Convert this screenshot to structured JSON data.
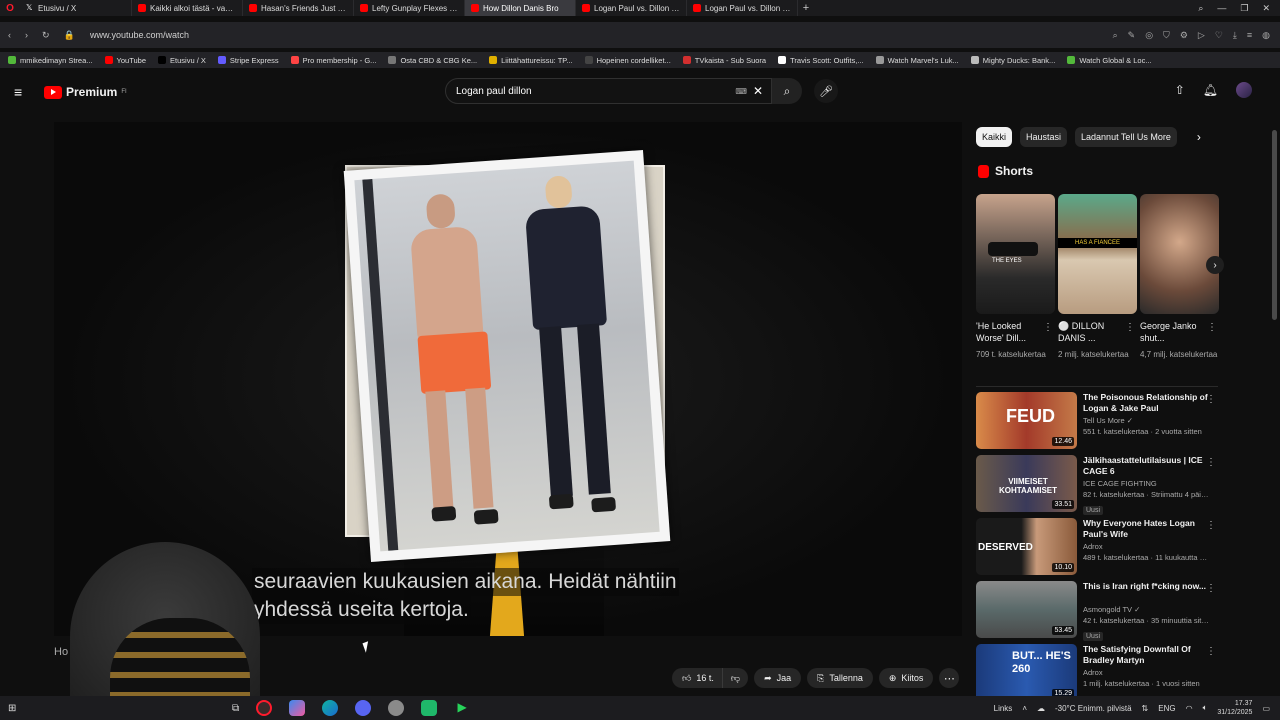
{
  "browser": {
    "tabs": [
      {
        "label": "Etusivu / X",
        "icon": "x-icon",
        "active": false
      },
      {
        "label": "Kaikki alkoi tästä - vapaaottelu",
        "icon": "youtube-icon",
        "active": false
      },
      {
        "label": "Hasan's Friends Just Expo",
        "icon": "youtube-icon",
        "active": false
      },
      {
        "label": "Lefty Gunplay Flexes his C",
        "icon": "youtube-icon",
        "active": false
      },
      {
        "label": "How Dillon Danis Bro",
        "icon": "youtube-icon",
        "active": true
      },
      {
        "label": "Logan Paul vs. Dillon Dan",
        "icon": "youtube-icon",
        "active": false
      },
      {
        "label": "Logan Paul vs. Dillon Dan",
        "icon": "youtube-icon",
        "active": false
      }
    ],
    "url": "www.youtube.com/watch",
    "bookmarks": [
      {
        "label": "mmikedimayn Strea...",
        "color": "#53b93b"
      },
      {
        "label": "YouTube",
        "color": "#ff0000"
      },
      {
        "label": "Etusivu / X",
        "color": "#000000"
      },
      {
        "label": "Stripe Express",
        "color": "#635bff"
      },
      {
        "label": "Pro membership - G...",
        "color": "#ff4444"
      },
      {
        "label": "Osta CBD & CBG Ke...",
        "color": "#777777"
      },
      {
        "label": "Liittähattureissu: TP...",
        "color": "#e0b000"
      },
      {
        "label": "Hopeinen cordelliket...",
        "color": "#444444"
      },
      {
        "label": "TVkaista - Sub Suora",
        "color": "#d32f2f"
      },
      {
        "label": "Travis Scott: Outfits,...",
        "color": "#ffffff"
      },
      {
        "label": "Watch Marvel's Luk...",
        "color": "#999999"
      },
      {
        "label": "Mighty Ducks: Bank...",
        "color": "#bbbbbb"
      },
      {
        "label": "Watch Global & Loc...",
        "color": "#53b93b"
      }
    ]
  },
  "youtube": {
    "logo_text": "Premium",
    "logo_sup": "FI",
    "search_value": "Logan paul dillon",
    "player": {
      "subtitle_line1": "seuraavien kuukausien aikana. Heidät nähtiin",
      "subtitle_line2": "yhdessä useita kertoja.",
      "webcam_text": "Ho"
    },
    "actions": {
      "likes": "16 t.",
      "share": "Jaa",
      "save": "Tallenna",
      "thanks": "Kiitos"
    },
    "chips": [
      "Kaikki",
      "Haustasi",
      "Ladannut Tell Us More"
    ],
    "shorts_header": "Shorts",
    "shorts": [
      {
        "title": "'He Looked Worse' Dill...",
        "views": "709 t. katselukertaa",
        "thumb_label": "THE EYES"
      },
      {
        "title": "⚪ DILLON DANIS ...",
        "views": "2 milj. katselukertaa",
        "thumb_label": "HAS A FIANCEE"
      },
      {
        "title": "George Janko shut...",
        "views": "4,7 milj. katselukertaa",
        "thumb_label": ""
      }
    ],
    "videos": [
      {
        "title": "The Poisonous Relationship of Logan & Jake Paul",
        "channel": "Tell Us More ✓",
        "stats": "551 t. katselukertaa · 2 vuotta sitten",
        "duration": "12.46",
        "thumb_text": "FEUD",
        "badge": ""
      },
      {
        "title": "Jälkihaastattelutilaisuus | ICE CAGE 6",
        "channel": "ICE CAGE FIGHTING",
        "stats": "82 t. katselukertaa · Striimattu 4 päivää sitten",
        "duration": "33.51",
        "thumb_text": "VIIMEISET KOHTAAMISET",
        "badge": "Uusi"
      },
      {
        "title": "Why Everyone Hates Logan Paul's Wife",
        "channel": "Adrox",
        "stats": "489 t. katselukertaa · 11 kuukautta sitten",
        "duration": "10.10",
        "thumb_text": "DESERVED",
        "badge": ""
      },
      {
        "title": "This is Iran right f*cking now...",
        "channel": "Asmongold TV ✓",
        "stats": "42 t. katselukertaa · 35 minuuttia sitten",
        "duration": "53.45",
        "thumb_text": "",
        "badge": "Uusi"
      },
      {
        "title": "The Satisfying Downfall Of Bradley Martyn",
        "channel": "Adrox",
        "stats": "1 milj. katselukertaa · 1 vuosi sitten",
        "duration": "15.29",
        "thumb_text": "BUT... HE'S 260",
        "badge": ""
      }
    ]
  },
  "taskbar": {
    "links": "Links",
    "weather": "-30°C  Enimm. pilvistä",
    "lang": "ENG",
    "time": "17.37",
    "date": "31/12/2025"
  },
  "colors": {
    "accent": "#ff0000",
    "background": "#0f0f0f",
    "subtitle_stripe": "#e3a81c"
  }
}
